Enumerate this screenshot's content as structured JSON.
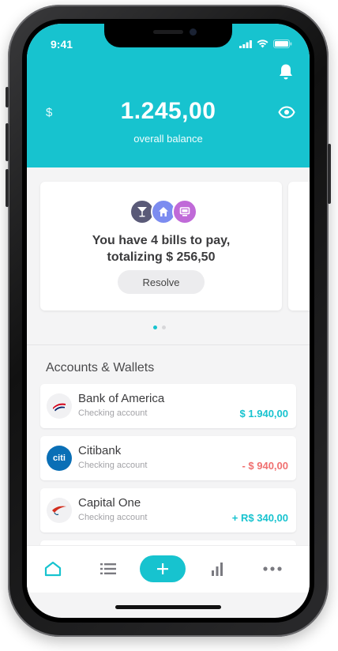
{
  "status": {
    "time": "9:41"
  },
  "header": {
    "currency_symbol": "$",
    "balance": "1.245,00",
    "balance_label": "overall balance",
    "icons": {
      "notifications": "bell-icon",
      "visibility": "eye-icon"
    }
  },
  "bills_card": {
    "line1": "You have 4 bills to pay,",
    "line2": "totalizing $ 256,50",
    "resolve_label": "Resolve",
    "icons": [
      "cocktail-icon",
      "home-icon",
      "monitor-icon"
    ],
    "icon_colors": [
      "#5a5a78",
      "#7c8cf0",
      "#c06ad8"
    ],
    "page_dots": 2,
    "active_dot": 0
  },
  "accounts": {
    "title": "Accounts & Wallets",
    "items": [
      {
        "name": "Bank of America",
        "type": "Checking account",
        "amount": "$ 1.940,00",
        "amount_color": "#17c3cf",
        "logo": "bank-of-america-logo"
      },
      {
        "name": "Citibank",
        "type": "Checking account",
        "amount": "- $ 940,00",
        "amount_color": "#f07070",
        "logo": "citi-logo",
        "logo_text": "citi"
      },
      {
        "name": "Capital One",
        "type": "Checking account",
        "amount": "+ R$ 340,00",
        "amount_color": "#17c3cf",
        "logo": "capital-one-logo"
      }
    ]
  },
  "tabbar": {
    "items": [
      "home-icon",
      "list-icon",
      "plus-icon",
      "bar-chart-icon",
      "more-icon"
    ],
    "active": 0,
    "accent": "#17c3cf"
  },
  "colors": {
    "accent": "#17c3cf",
    "negative": "#f07070",
    "text": "#3b3b3d"
  }
}
